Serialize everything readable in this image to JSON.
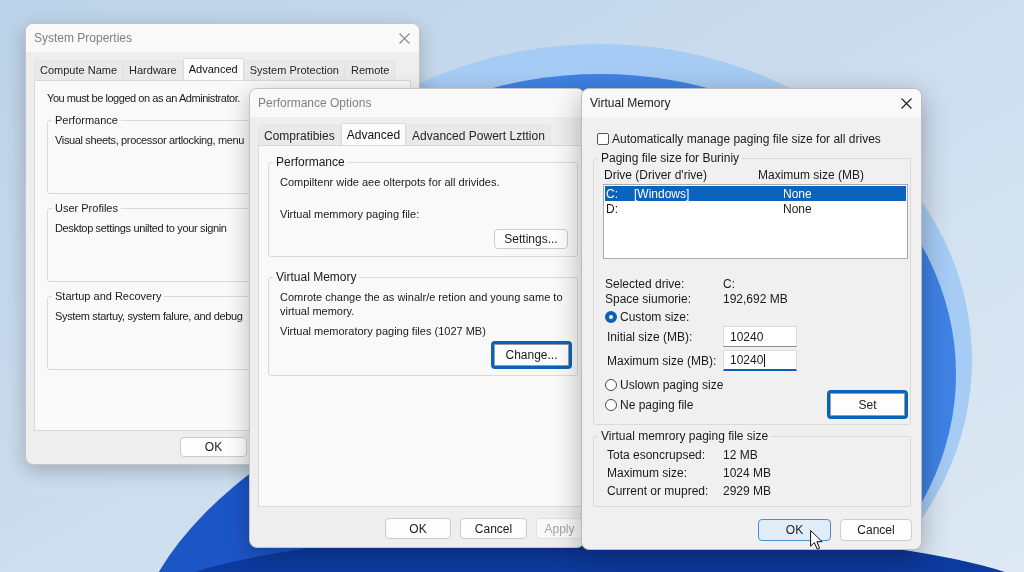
{
  "system_properties": {
    "title": "System Properties",
    "active": false,
    "tabs": [
      {
        "label": "Compute Name",
        "selected": false
      },
      {
        "label": "Hardware",
        "selected": false
      },
      {
        "label": "Advanced",
        "selected": true
      },
      {
        "label": "System Protection",
        "selected": false
      },
      {
        "label": "Remote",
        "selected": false
      }
    ],
    "notice": "You must be logged on as an Administrator.",
    "groups": [
      {
        "title": "Performance",
        "text": "Visual sheets, processor artlocking, menu"
      },
      {
        "title": "User Profiles",
        "text": "Desktop settings unilted to your signin"
      },
      {
        "title": "Startup and Recovery",
        "text": "System startuy, system falure, and debug"
      }
    ],
    "buttons": [
      {
        "label": "OK"
      }
    ]
  },
  "performance_options": {
    "title": "Performance Options",
    "active": false,
    "tabs": [
      {
        "label": "Compratibies",
        "selected": false
      },
      {
        "label": "Advanced",
        "selected": true
      },
      {
        "label": "Advanced Powert Lzttion",
        "selected": false
      }
    ],
    "performance_group": {
      "title": "Performance",
      "description": "Compiltenr wide aee olterpots for all drivides.",
      "paging_label": "Virtual memmory paging file:",
      "button": {
        "label": "Settings...",
        "focused": false
      }
    },
    "virtual_memory_group": {
      "title": "Virtual Memory",
      "description": "Comrote change the as winalr/e retion and young same to virtual memory.",
      "paging_total": "Virtual memoratory paging files (1027 MB)",
      "button": {
        "label": "Change...",
        "focused": true
      }
    },
    "buttons": [
      {
        "label": "OK",
        "disabled": false
      },
      {
        "label": "Cancel",
        "disabled": false
      },
      {
        "label": "Apply",
        "disabled": true
      }
    ]
  },
  "virtual_memory": {
    "title": "Virtual Memory",
    "active": true,
    "auto_manage": {
      "label": "Automatically manage paging file size for all drives",
      "checked": false
    },
    "paging_group": {
      "title": "Paging file size for Buriniy",
      "columns": [
        "Drive (Driver d'rive)",
        "Maximum size (MB)"
      ],
      "drives": [
        {
          "drive": "C:",
          "label": "[Windows]",
          "size": "None",
          "selected": true
        },
        {
          "drive": "D:",
          "size": "None",
          "selected": false
        }
      ],
      "info": [
        {
          "label": "Selected drive:",
          "value": "C:"
        },
        {
          "label": "Space siumorie:",
          "value": "192,692 MB"
        }
      ],
      "size_options": [
        {
          "label": "Custom size:",
          "selected": true
        },
        {
          "label": "Uslown paging size",
          "selected": false
        },
        {
          "label": "Ne paging file",
          "selected": false
        }
      ],
      "size_fields": [
        {
          "label": "Initial size (MB):",
          "value": "10240",
          "focused": false
        },
        {
          "label": "Maximum size (MB):",
          "value": "10240",
          "focused": true
        }
      ],
      "set_button": {
        "label": "Set",
        "focused": true
      }
    },
    "totals_group": {
      "title": "Virtual memrory paging file size",
      "rows": [
        {
          "label": "Tota esoncrupsed:",
          "value": "12 MB"
        },
        {
          "label": "Maximum size:",
          "value": "1024 MB"
        },
        {
          "label": "Current or mupred:",
          "value": "2929 MB"
        }
      ]
    },
    "buttons": [
      {
        "label": "OK",
        "default": true
      },
      {
        "label": "Cancel",
        "default": false
      }
    ]
  }
}
